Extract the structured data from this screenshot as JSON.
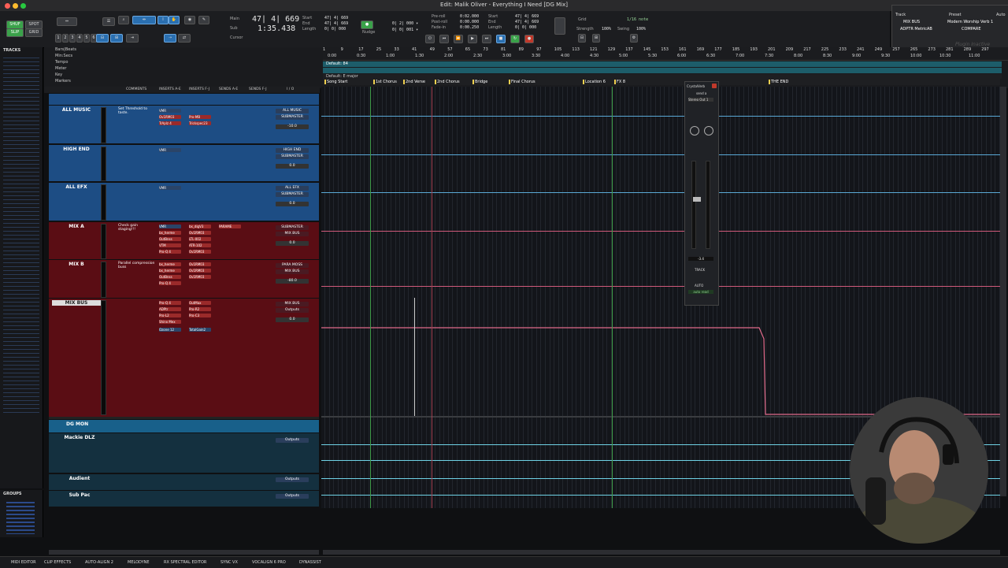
{
  "window": {
    "title": "Edit: Malik Oliver - Everything I Need [DG Mix]"
  },
  "toolbar": {
    "main_counter": "47| 4| 669",
    "sub_counter": "1:35.438",
    "counter_labels": [
      "Main",
      "Sub",
      "Cursor"
    ],
    "selection_labels": [
      "Start",
      "End",
      "Length"
    ],
    "selection_values": [
      "47| 4| 669",
      "47| 4| 669",
      "0| 0| 000"
    ],
    "grid_label": "Grid",
    "grid_value": "1/16 note",
    "strength_label": "Strength",
    "strength_value": "100%",
    "swing_label": "Swing",
    "swing_value": "100%",
    "nudge_label": "Nudge",
    "preroll_labels": [
      "Pre-roll",
      "Post-roll",
      "Fade-in"
    ],
    "preroll_values": [
      "0:02.000",
      "0:00.000",
      "0:00.250"
    ],
    "nums": [
      "1",
      "2",
      "3",
      "4",
      "5",
      "6"
    ]
  },
  "plugin_panel": {
    "track_label": "Track",
    "preset_label": "Preset",
    "auto_label": "Auto",
    "track_value": "MIX BUS",
    "preset_value": "Modern Worship Verb 1",
    "insert_value": "ADPTR MetricAB",
    "compare_label": "COMPARE",
    "inactive_label": "Plugin Inactive"
  },
  "tracks_panel": {
    "title": "TRACKS",
    "groups_title": "GROUPS"
  },
  "rulers": {
    "items": [
      "Bars|Beats",
      "Min:Secs",
      "Tempo",
      "Meter",
      "Key",
      "Markers"
    ]
  },
  "timeline": {
    "bar_ticks": [
      "1",
      "9",
      "17",
      "25",
      "33",
      "41",
      "49",
      "57",
      "65",
      "73",
      "81",
      "89",
      "97",
      "105",
      "113",
      "121",
      "129",
      "137",
      "145",
      "153",
      "161",
      "169",
      "177",
      "185",
      "193",
      "201",
      "209",
      "217",
      "225",
      "233",
      "241",
      "249",
      "257",
      "265",
      "273",
      "281",
      "289",
      "297"
    ],
    "time_ticks": [
      "0:00",
      "0:30",
      "1:00",
      "1:30",
      "2:00",
      "2:30",
      "3:00",
      "3:30",
      "4:00",
      "4:30",
      "5:00",
      "5:30",
      "6:00",
      "6:30",
      "7:00",
      "7:30",
      "8:00",
      "8:30",
      "9:00",
      "9:30",
      "10:00",
      "10:30",
      "11:00"
    ],
    "tempo_text": "Default: 84",
    "key_text": "Default: E major",
    "markers": [
      "Song Start",
      "1st Chorus",
      "2nd Verse",
      "2nd Chorus",
      "Bridge",
      "Final Chorus",
      "Location 6",
      "FX 8",
      "THE END"
    ]
  },
  "mix_columns": [
    "COMMENTS",
    "INSERTS A-E",
    "INSERTS F-J",
    "SENDS A-E",
    "SENDS F-J",
    "I / O"
  ],
  "tracks": [
    {
      "name": "ALL MUSIC",
      "comment": "Set Threshold to taste.",
      "inserts": [
        "VMR",
        "Ov1RM03",
        "TrAplz 4"
      ],
      "inserts_b": [
        "Pro-MB",
        "Trickspec23",
        ""
      ],
      "io": [
        "ALL MUSIC",
        "SUBMASTER"
      ],
      "vol": "-10.0"
    },
    {
      "name": "HIGH END",
      "comment": "",
      "inserts": [
        "VMR"
      ],
      "inserts_b": [],
      "io": [
        "HIGH END",
        "SUBMASTER"
      ],
      "vol": "0.0"
    },
    {
      "name": "ALL EFX",
      "comment": "",
      "inserts": [
        "VMR"
      ],
      "inserts_b": [],
      "io": [
        "ALL EFX",
        "SUBMASTER"
      ],
      "vol": "0.0"
    },
    {
      "name": "MIX A",
      "comment": "Check gain staging!!!",
      "inserts": [
        "VMR",
        "bx_herme",
        "OutBnss",
        "VTM",
        "Pro-Q 4"
      ],
      "inserts_b": [
        "bx_digV3",
        "Ov1RM03",
        "LTL-002",
        "ATR-102",
        "Ov1RM03"
      ],
      "io": [
        "SUBMASTER",
        "MIX BUS"
      ],
      "vol": "0.0"
    },
    {
      "name": "MIX B",
      "comment": "Parallel compression buss",
      "inserts": [
        "bx_herme",
        "bx_herme",
        "OutBnss",
        "Pro-Q 4"
      ],
      "inserts_b": [
        "Ov1RM03",
        "Ov1RM03",
        "Ov1RM03",
        ""
      ],
      "io": [
        "PARA MOSS",
        "MIX BUS"
      ],
      "vol": "-80.0"
    },
    {
      "name": "MIX BUS",
      "comment": "",
      "inserts": [
        "Pro-Q 4",
        "ADPtr",
        "Pro-L2",
        "Shinx Mex",
        "Ozone 12"
      ],
      "inserts_b": [
        "OutMax",
        "Pro-R2",
        "Pro-C3",
        "",
        "TotalGain2"
      ],
      "io": [
        "MIX BUS",
        "Outputs"
      ],
      "vol": "0.0"
    }
  ],
  "monitor_tracks": [
    {
      "name": "DG MON",
      "io": ""
    },
    {
      "name": "Mackie DLZ",
      "io": "Outputs"
    },
    {
      "name": "Audient",
      "io": "Outputs"
    },
    {
      "name": "Sub Pac",
      "io": "Outputs"
    }
  ],
  "floater": {
    "title": "CrystalVerb",
    "send": "send a",
    "dest": "Stereo Out 1",
    "track_label": "TRACK",
    "auto_label": "AUTO",
    "auto_value": "auto read",
    "vol": "-3.4"
  },
  "bottom_tabs": [
    "MIDI EDITOR",
    "CLIP EFFECTS",
    "AUTO-ALIGN 2",
    "MELODYNE",
    "RX SPECTRAL EDITOR",
    "SYNC VX",
    "VOCALIGN 6 PRO",
    "DYNASSIST"
  ],
  "colors": {
    "accent_blue": "#1d4d84",
    "accent_red": "#5a0d14",
    "accent_teal": "#17506a",
    "marker_yellow": "#f0d050",
    "playhead_green": "#4caf50"
  }
}
